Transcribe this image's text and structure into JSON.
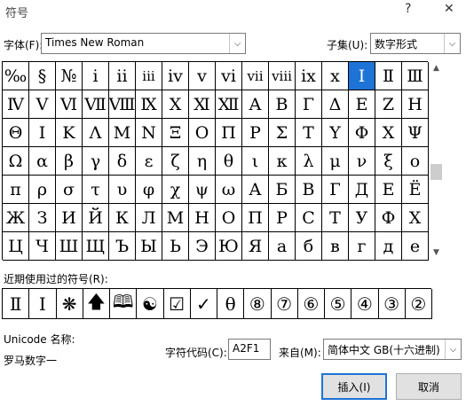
{
  "window": {
    "title": "符号",
    "help_glyph": "?",
    "close_glyph": "✕"
  },
  "font": {
    "label": "字体(F):",
    "value": "Times New Roman"
  },
  "subset": {
    "label": "子集(U):",
    "value": "数字形式"
  },
  "grid": {
    "rows": [
      [
        "‰",
        "§",
        "№",
        "i",
        "ii",
        "iii",
        "iv",
        "v",
        "vi",
        "vii",
        "viii",
        "ix",
        "x",
        "Ⅰ",
        "Ⅱ",
        "Ⅲ"
      ],
      [
        "Ⅳ",
        "Ⅴ",
        "Ⅵ",
        "Ⅶ",
        "Ⅷ",
        "Ⅸ",
        "Ⅹ",
        "Ⅺ",
        "Ⅻ",
        "Α",
        "Β",
        "Γ",
        "Δ",
        "Ε",
        "Ζ",
        "Η"
      ],
      [
        "Θ",
        "Ι",
        "Κ",
        "Λ",
        "Μ",
        "Ν",
        "Ξ",
        "Ο",
        "Π",
        "Ρ",
        "Σ",
        "Τ",
        "Υ",
        "Φ",
        "Χ",
        "Ψ"
      ],
      [
        "Ω",
        "α",
        "β",
        "γ",
        "δ",
        "ε",
        "ζ",
        "η",
        "θ",
        "ι",
        "κ",
        "λ",
        "μ",
        "ν",
        "ξ",
        "ο"
      ],
      [
        "π",
        "ρ",
        "σ",
        "τ",
        "υ",
        "φ",
        "χ",
        "ψ",
        "ω",
        "А",
        "Б",
        "В",
        "Г",
        "Д",
        "Е",
        "Ё"
      ],
      [
        "Ж",
        "З",
        "И",
        "Й",
        "К",
        "Л",
        "М",
        "Н",
        "О",
        "П",
        "Р",
        "С",
        "Т",
        "У",
        "Ф",
        "Х"
      ],
      [
        "Ц",
        "Ч",
        "Ш",
        "Щ",
        "Ъ",
        "Ы",
        "Ь",
        "Э",
        "Ю",
        "Я",
        "а",
        "б",
        "в",
        "г",
        "д",
        "е"
      ]
    ],
    "selected": {
      "row": 0,
      "col": 13
    }
  },
  "recent": {
    "label": "近期使用过的符号(R):",
    "items": [
      "Ⅱ",
      "Ⅰ",
      "❋",
      "🡅",
      "🕮",
      "☯",
      "☑",
      "✓",
      "θ",
      "⑧",
      "⑦",
      "⑥",
      "⑤",
      "④",
      "③",
      "②"
    ]
  },
  "unicode": {
    "label": "Unicode 名称:",
    "name": "罗马数字一"
  },
  "char_code": {
    "label": "字符代码(C):",
    "value": "A2F1"
  },
  "from": {
    "label": "来自(M):",
    "value": "简体中文 GB(十六进制)"
  },
  "buttons": {
    "insert": "插入(I)",
    "cancel": "取消"
  },
  "scroll": {
    "up_glyph": "▲",
    "down_glyph": "▼"
  },
  "dropdown_glyph": "⌵"
}
